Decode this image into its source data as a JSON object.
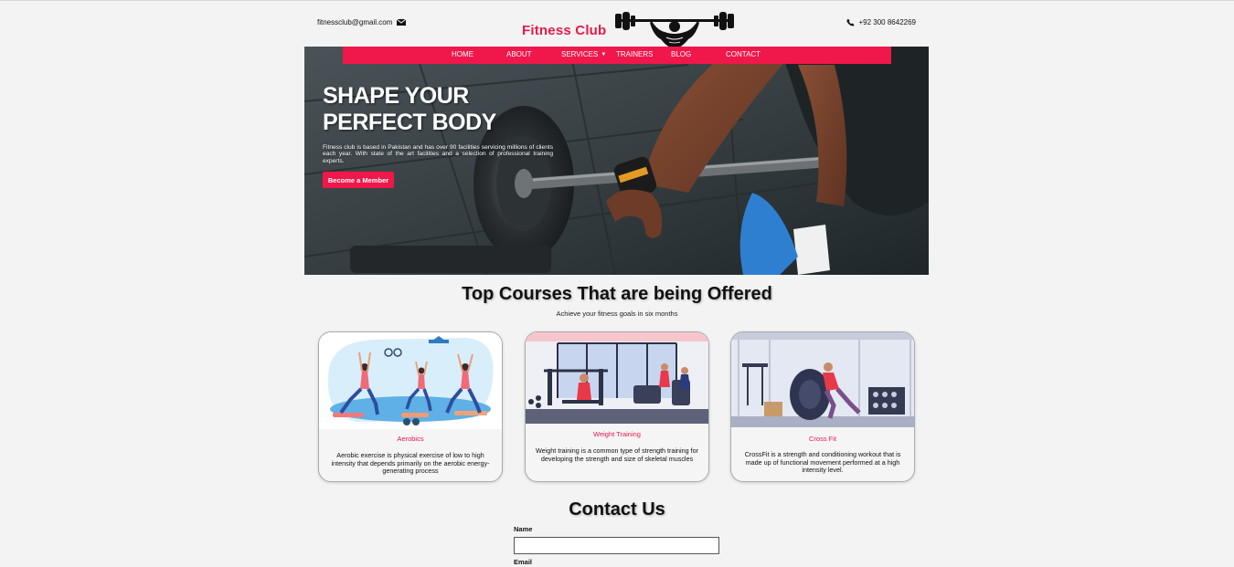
{
  "header": {
    "email": "fitnessclub@gmail.com",
    "brand": "Fitness Club",
    "phone": "+92 300 8642269"
  },
  "nav": {
    "items": [
      {
        "label": "HOME"
      },
      {
        "label": "ABOUT"
      },
      {
        "label": "SERVICES"
      },
      {
        "label": "TRAINERS"
      },
      {
        "label": "BLOG"
      },
      {
        "label": "CONTACT"
      }
    ]
  },
  "hero": {
    "title_line1": "SHAPE YOUR",
    "title_line2": "PERFECT BODY",
    "description": "Fitness club is based in Pakistan and has over 90 facilities servicing millions of clients each year. With state of the art facilities and a selection of professional training experts.",
    "button": "Become a Member"
  },
  "courses": {
    "title": "Top Courses That are being Offered",
    "subtitle": "Achieve your fitness goals in six months",
    "items": [
      {
        "name": "Aerobics",
        "text": "Aerobic exercise is physical exercise of low to high intensity that depends primarily on the aerobic energy-generating process"
      },
      {
        "name": "Weight Training",
        "text": "Weight training is a common type of strength training for developing the strength and size of skeletal muscles"
      },
      {
        "name": "Cross Fit",
        "text": "CrossFit is a strength and conditioning workout that is made up of functional movement performed at a high intensity level."
      }
    ]
  },
  "contact": {
    "title": "Contact Us",
    "name_label": "Name",
    "email_label": "Email"
  },
  "colors": {
    "accent": "#f0174b",
    "background": "#f3f3f3"
  }
}
